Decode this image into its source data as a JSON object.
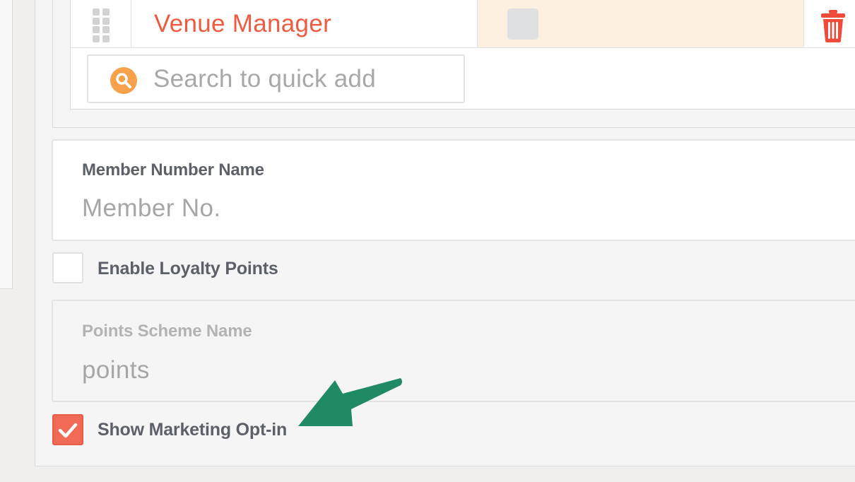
{
  "roles": {
    "row": {
      "name": "Venue Manager"
    },
    "search": {
      "placeholder": "Search to quick add"
    }
  },
  "member_number": {
    "label": "Member Number Name",
    "value": "Member No."
  },
  "loyalty": {
    "label": "Enable Loyalty Points",
    "checked": false
  },
  "points_scheme": {
    "label": "Points Scheme Name",
    "value": "points"
  },
  "marketing": {
    "label": "Show Marketing Opt-in",
    "checked": true
  },
  "colors": {
    "accent": "#f16a56",
    "arrow": "#1f8a64",
    "search_icon": "#f7a24b",
    "highlight": "#fdf0e0"
  },
  "icons": [
    "drag-handle-icon",
    "trash-icon",
    "search-icon",
    "checkmark-icon",
    "pointer-arrow-icon"
  ]
}
